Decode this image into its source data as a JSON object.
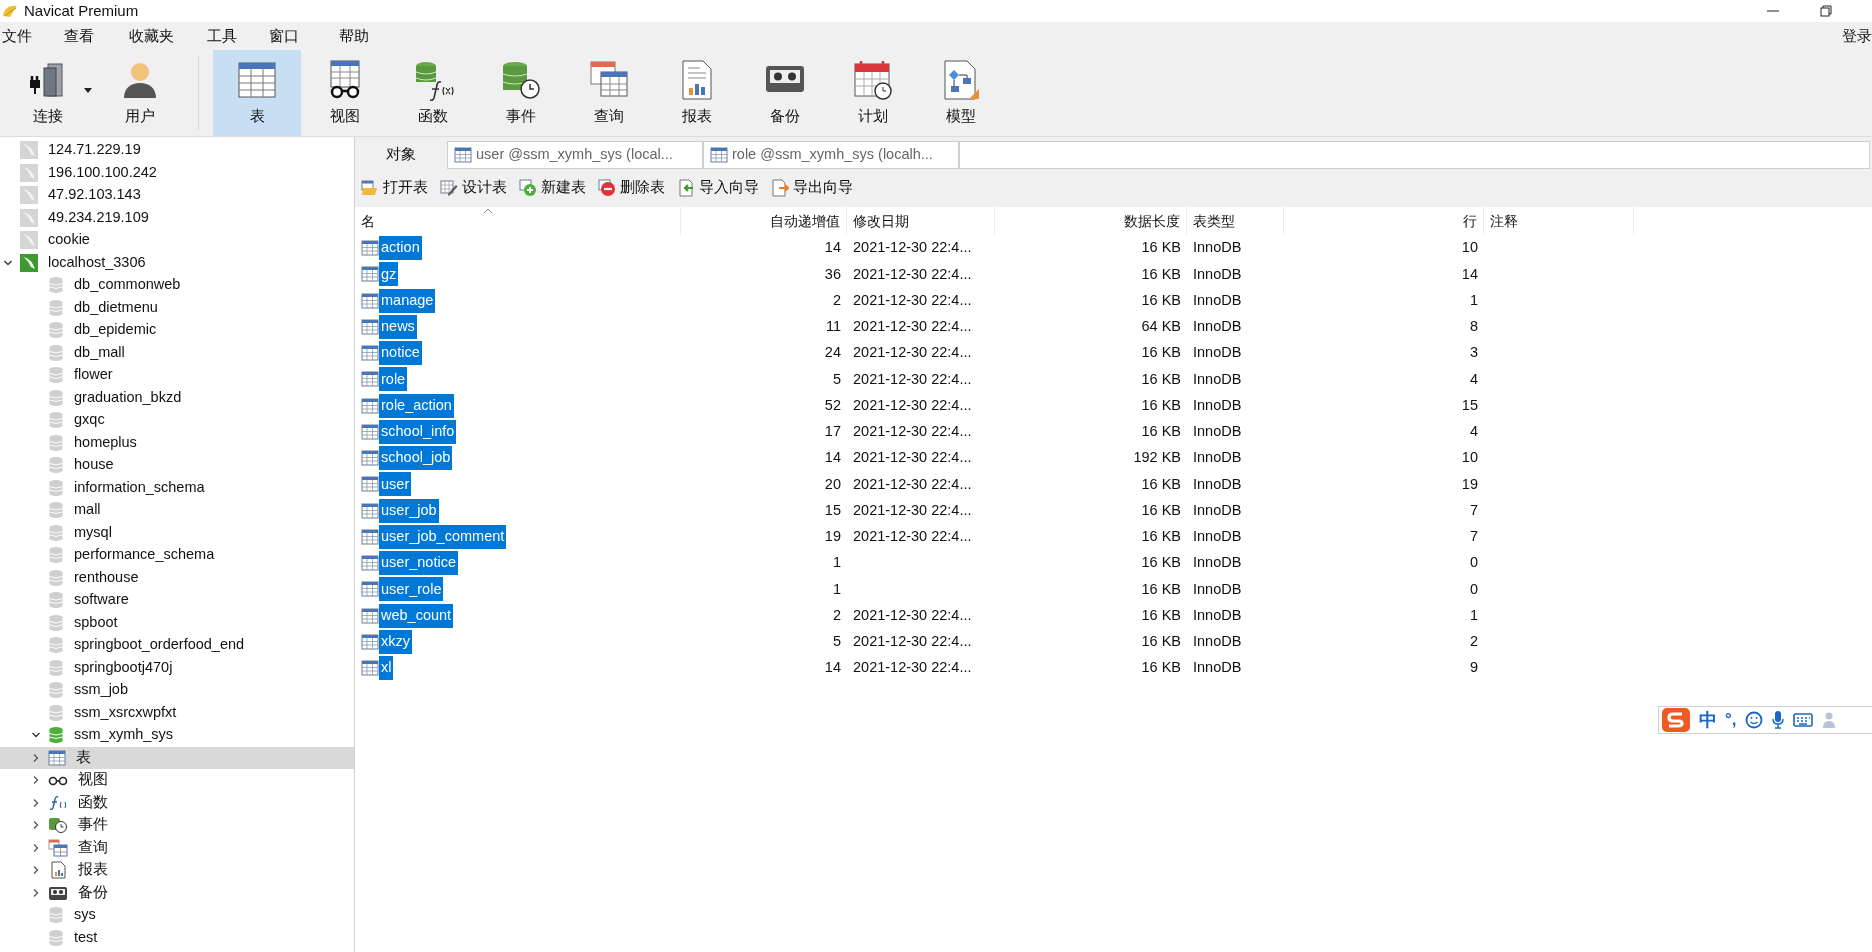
{
  "window": {
    "title": "Navicat Premium"
  },
  "menu": [
    "文件",
    "查看",
    "收藏夹",
    "工具",
    "窗口",
    "帮助"
  ],
  "login": "登录",
  "toolbar": [
    {
      "kind": "connection",
      "label": "连接",
      "selected": false
    },
    {
      "kind": "user",
      "label": "用户",
      "selected": false
    },
    {
      "kind": "table",
      "label": "表",
      "selected": true
    },
    {
      "kind": "view",
      "label": "视图",
      "selected": false
    },
    {
      "kind": "function",
      "label": "函数",
      "selected": false
    },
    {
      "kind": "event",
      "label": "事件",
      "selected": false
    },
    {
      "kind": "query",
      "label": "查询",
      "selected": false
    },
    {
      "kind": "report",
      "label": "报表",
      "selected": false
    },
    {
      "kind": "backup",
      "label": "备份",
      "selected": false
    },
    {
      "kind": "schedule",
      "label": "计划",
      "selected": false
    },
    {
      "kind": "model",
      "label": "模型",
      "selected": false
    }
  ],
  "sidebar": {
    "items": [
      {
        "kind": "connection",
        "label": "124.71.229.19",
        "connected": false,
        "selected": false
      },
      {
        "kind": "connection",
        "label": "196.100.100.242",
        "connected": false,
        "selected": false
      },
      {
        "kind": "connection",
        "label": "47.92.103.143",
        "connected": false,
        "selected": false
      },
      {
        "kind": "connection",
        "label": "49.234.219.109",
        "connected": false,
        "selected": false
      },
      {
        "kind": "connection",
        "label": "cookie",
        "connected": false,
        "selected": false
      },
      {
        "kind": "connection",
        "label": "localhost_3306",
        "connected": true,
        "expanded": true,
        "selected": false,
        "children": [
          {
            "kind": "database",
            "label": "db_commonweb",
            "open": false,
            "selected": false
          },
          {
            "kind": "database",
            "label": "db_dietmenu",
            "open": false,
            "selected": false
          },
          {
            "kind": "database",
            "label": "db_epidemic",
            "open": false,
            "selected": false
          },
          {
            "kind": "database",
            "label": "db_mall",
            "open": false,
            "selected": false
          },
          {
            "kind": "database",
            "label": "flower",
            "open": false,
            "selected": false
          },
          {
            "kind": "database",
            "label": "graduation_bkzd",
            "open": false,
            "selected": false
          },
          {
            "kind": "database",
            "label": "gxqc",
            "open": false,
            "selected": false
          },
          {
            "kind": "database",
            "label": "homeplus",
            "open": false,
            "selected": false
          },
          {
            "kind": "database",
            "label": "house",
            "open": false,
            "selected": false
          },
          {
            "kind": "database",
            "label": "information_schema",
            "open": false,
            "selected": false
          },
          {
            "kind": "database",
            "label": "mall",
            "open": false,
            "selected": false
          },
          {
            "kind": "database",
            "label": "mysql",
            "open": false,
            "selected": false
          },
          {
            "kind": "database",
            "label": "performance_schema",
            "open": false,
            "selected": false
          },
          {
            "kind": "database",
            "label": "renthouse",
            "open": false,
            "selected": false
          },
          {
            "kind": "database",
            "label": "software",
            "open": false,
            "selected": false
          },
          {
            "kind": "database",
            "label": "spboot",
            "open": false,
            "selected": false
          },
          {
            "kind": "database",
            "label": "springboot_orderfood_end",
            "open": false,
            "selected": false
          },
          {
            "kind": "database",
            "label": "springbootj470j",
            "open": false,
            "selected": false
          },
          {
            "kind": "database",
            "label": "ssm_job",
            "open": false,
            "selected": false
          },
          {
            "kind": "database",
            "label": "ssm_xsrcxwpfxt",
            "open": false,
            "selected": false
          },
          {
            "kind": "database",
            "label": "ssm_xymh_sys",
            "open": true,
            "expanded": true,
            "selected": false,
            "children": [
              {
                "kind": "table",
                "label": "表",
                "expanded": false,
                "selected": true
              },
              {
                "kind": "view",
                "label": "视图",
                "expanded": false,
                "selected": false
              },
              {
                "kind": "function",
                "label": "函数",
                "expanded": false,
                "selected": false
              },
              {
                "kind": "event",
                "label": "事件",
                "expanded": false,
                "selected": false
              },
              {
                "kind": "query",
                "label": "查询",
                "expanded": false,
                "selected": false
              },
              {
                "kind": "report",
                "label": "报表",
                "expanded": false,
                "selected": false
              },
              {
                "kind": "backup",
                "label": "备份",
                "expanded": false,
                "selected": false
              }
            ]
          },
          {
            "kind": "database",
            "label": "sys",
            "open": false,
            "selected": false
          },
          {
            "kind": "database",
            "label": "test",
            "open": false,
            "selected": false
          }
        ]
      }
    ]
  },
  "tabs": [
    {
      "kind": "objects",
      "label": "对象",
      "selected": true
    },
    {
      "kind": "table",
      "label": "user @ssm_xymh_sys (local...",
      "selected": false
    },
    {
      "kind": "table",
      "label": "role @ssm_xymh_sys (localh...",
      "selected": false
    }
  ],
  "object_toolbar": [
    {
      "kind": "open",
      "label": "打开表"
    },
    {
      "kind": "design",
      "label": "设计表"
    },
    {
      "kind": "new",
      "label": "新建表"
    },
    {
      "kind": "delete",
      "label": "删除表"
    },
    {
      "kind": "import",
      "label": "导入向导"
    },
    {
      "kind": "export",
      "label": "导出向导"
    }
  ],
  "table": {
    "columns": [
      "名",
      "自动递增值",
      "修改日期",
      "数据长度",
      "表类型",
      "行",
      "注释"
    ],
    "rows": [
      {
        "name": "action",
        "auto_increment": "14",
        "modified": "2021-12-30 22:4...",
        "data_length": "16 KB",
        "engine": "InnoDB",
        "rows": "10",
        "selected": true
      },
      {
        "name": "gz",
        "auto_increment": "36",
        "modified": "2021-12-30 22:4...",
        "data_length": "16 KB",
        "engine": "InnoDB",
        "rows": "14",
        "selected": true
      },
      {
        "name": "manage",
        "auto_increment": "2",
        "modified": "2021-12-30 22:4...",
        "data_length": "16 KB",
        "engine": "InnoDB",
        "rows": "1",
        "selected": true
      },
      {
        "name": "news",
        "auto_increment": "11",
        "modified": "2021-12-30 22:4...",
        "data_length": "64 KB",
        "engine": "InnoDB",
        "rows": "8",
        "selected": true
      },
      {
        "name": "notice",
        "auto_increment": "24",
        "modified": "2021-12-30 22:4...",
        "data_length": "16 KB",
        "engine": "InnoDB",
        "rows": "3",
        "selected": true
      },
      {
        "name": "role",
        "auto_increment": "5",
        "modified": "2021-12-30 22:4...",
        "data_length": "16 KB",
        "engine": "InnoDB",
        "rows": "4",
        "selected": true
      },
      {
        "name": "role_action",
        "auto_increment": "52",
        "modified": "2021-12-30 22:4...",
        "data_length": "16 KB",
        "engine": "InnoDB",
        "rows": "15",
        "selected": true
      },
      {
        "name": "school_info",
        "auto_increment": "17",
        "modified": "2021-12-30 22:4...",
        "data_length": "16 KB",
        "engine": "InnoDB",
        "rows": "4",
        "selected": true
      },
      {
        "name": "school_job",
        "auto_increment": "14",
        "modified": "2021-12-30 22:4...",
        "data_length": "192 KB",
        "engine": "InnoDB",
        "rows": "10",
        "selected": true
      },
      {
        "name": "user",
        "auto_increment": "20",
        "modified": "2021-12-30 22:4...",
        "data_length": "16 KB",
        "engine": "InnoDB",
        "rows": "19",
        "selected": true
      },
      {
        "name": "user_job",
        "auto_increment": "15",
        "modified": "2021-12-30 22:4...",
        "data_length": "16 KB",
        "engine": "InnoDB",
        "rows": "7",
        "selected": true
      },
      {
        "name": "user_job_comment",
        "auto_increment": "19",
        "modified": "2021-12-30 22:4...",
        "data_length": "16 KB",
        "engine": "InnoDB",
        "rows": "7",
        "selected": true
      },
      {
        "name": "user_notice",
        "auto_increment": "1",
        "data_length": "16 KB",
        "engine": "InnoDB",
        "rows": "0",
        "selected": true
      },
      {
        "name": "user_role",
        "auto_increment": "1",
        "data_length": "16 KB",
        "engine": "InnoDB",
        "rows": "0",
        "selected": true
      },
      {
        "name": "web_count",
        "auto_increment": "2",
        "modified": "2021-12-30 22:4...",
        "data_length": "16 KB",
        "engine": "InnoDB",
        "rows": "1",
        "selected": true
      },
      {
        "name": "xkzy",
        "auto_increment": "5",
        "modified": "2021-12-30 22:4...",
        "data_length": "16 KB",
        "engine": "InnoDB",
        "rows": "2",
        "selected": true
      },
      {
        "name": "xl",
        "auto_increment": "14",
        "modified": "2021-12-30 22:4...",
        "data_length": "16 KB",
        "engine": "InnoDB",
        "rows": "9",
        "selected": true
      }
    ]
  },
  "ime_bar": {
    "mode": "中",
    "punctuation": "°,"
  }
}
